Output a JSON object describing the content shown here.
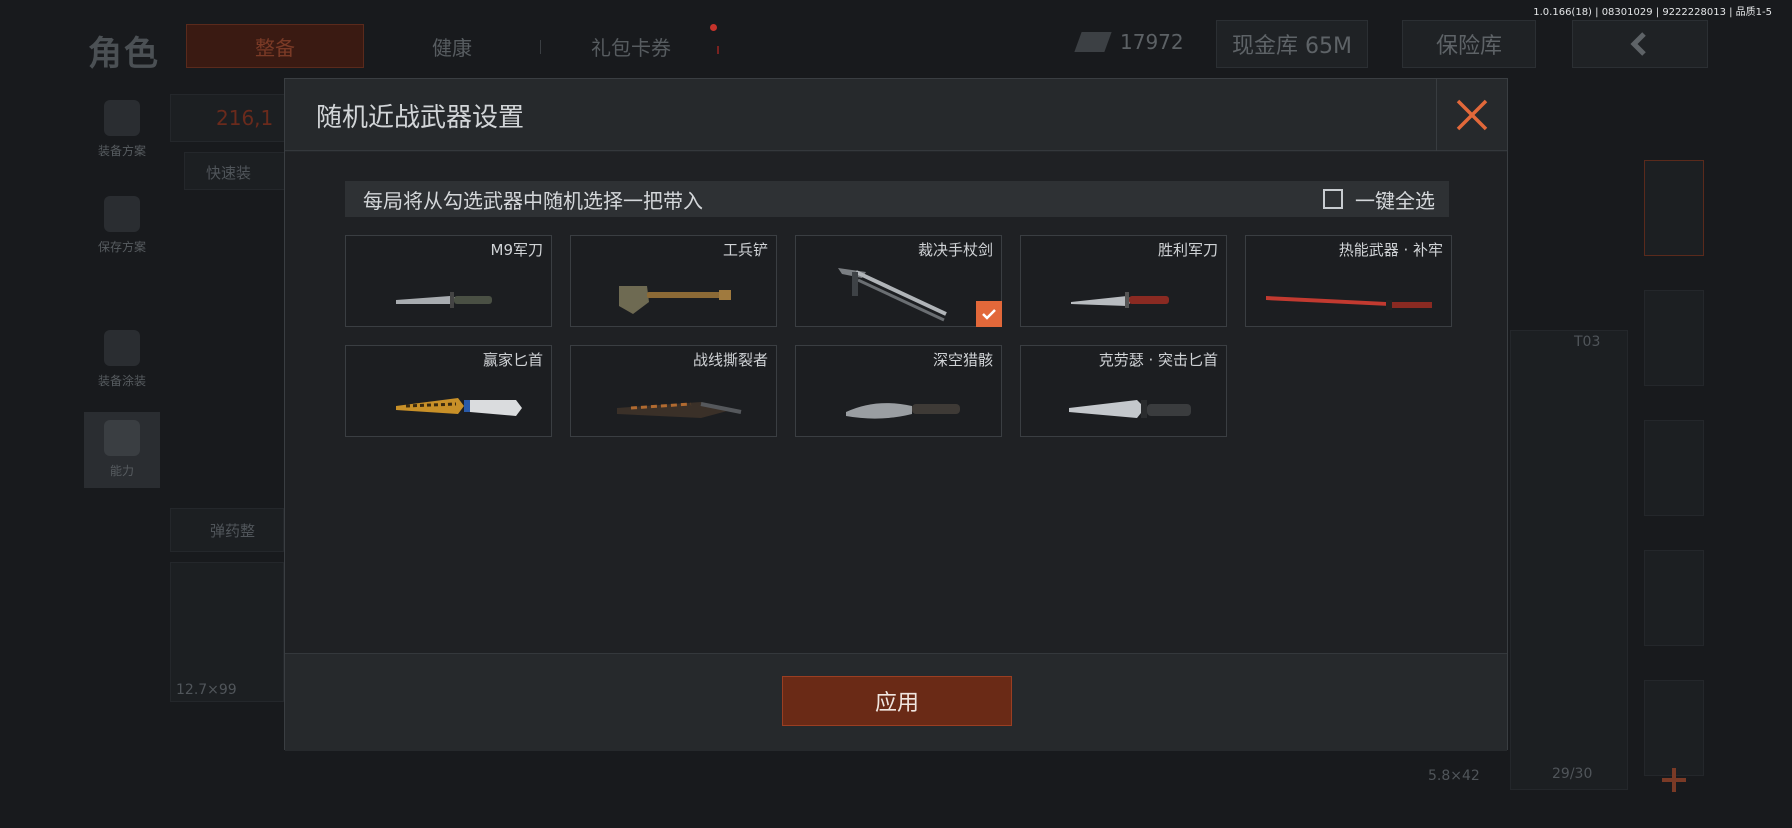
{
  "version": "1.0.166(18) | 08301029 | 9222228013 | 品质1-5",
  "background": {
    "title": "角色",
    "tabs": [
      "整备",
      "健康",
      "礼包卡券"
    ],
    "currency_value": "17972",
    "cash_store_label": "现金库 65M",
    "safe_label": "保险库",
    "left_menu": [
      "装备方案",
      "保存方案",
      "装备涂装",
      "能力"
    ],
    "quick_label": "快速装",
    "ammo_label": "弹药整",
    "value_partial": "216,1",
    "caliber_left": "12.7×99",
    "caliber_right": "5.8×42",
    "ammo_count": "29/30",
    "slot_label": "T03"
  },
  "modal": {
    "title": "随机近战武器设置",
    "info_text": "每局将从勾选武器中随机选择一把带入",
    "select_all_label": "一键全选",
    "weapons": [
      {
        "name": "M9军刀",
        "checked": false,
        "icon": "bayonet-icon"
      },
      {
        "name": "工兵铲",
        "checked": false,
        "icon": "shovel-icon"
      },
      {
        "name": "裁决手杖剑",
        "checked": true,
        "icon": "cane-sword-icon"
      },
      {
        "name": "胜利军刀",
        "checked": false,
        "icon": "red-knife-icon"
      },
      {
        "name": "热能武器 · 补牢",
        "checked": false,
        "icon": "katana-icon"
      },
      {
        "name": "赢家匕首",
        "checked": false,
        "icon": "gold-dagger-icon"
      },
      {
        "name": "战线撕裂者",
        "checked": false,
        "icon": "serrated-blade-icon"
      },
      {
        "name": "深空猎骸",
        "checked": false,
        "icon": "curved-blade-icon"
      },
      {
        "name": "克劳瑟 · 突击匕首",
        "checked": false,
        "icon": "combat-knife-icon"
      }
    ],
    "apply_label": "应用"
  },
  "colors": {
    "accent": "#e2683a",
    "apply_bg": "#6a2a16"
  }
}
